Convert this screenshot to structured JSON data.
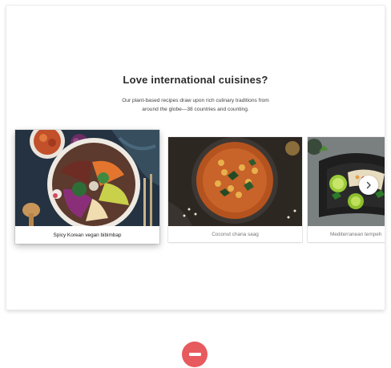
{
  "section": {
    "headline_prefix": "Love ",
    "headline_emphasis": "international cuisines?",
    "subtitle_line1": "Our plant-based recipes draw upon rich culinary traditions from",
    "subtitle_line2": "around the globe—38 countries and counting."
  },
  "carousel": {
    "items": [
      {
        "caption": "Spicy Korean vegan bibimbap",
        "image_icon": "bibimbap-photo"
      },
      {
        "caption": "Coconut chana saag",
        "image_icon": "chana-saag-photo"
      },
      {
        "caption": "Mediterranean tempeh",
        "image_icon": "tempeh-photo"
      }
    ],
    "next_icon": "chevron-right-icon"
  },
  "remove": {
    "icon": "minus-icon"
  },
  "colors": {
    "remove_button": "#e75a5e",
    "heading_text": "#2b2b2b",
    "caption_muted": "#777777",
    "card_bg": "#ffffff"
  }
}
